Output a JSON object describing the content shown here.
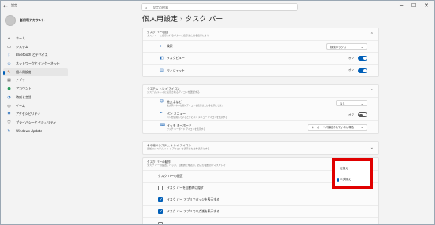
{
  "window": {
    "title": "設定",
    "back_icon": "arrow-left-icon",
    "search_placeholder": "設定の検索",
    "minimize": "─",
    "maximize": "☐",
    "close": "✕"
  },
  "profile": {
    "name": "者前利アカウント"
  },
  "sidebar": {
    "items": [
      {
        "label": "ホーム",
        "icon": "home-icon",
        "glyph": "⌂",
        "active": false
      },
      {
        "label": "システム",
        "icon": "monitor-icon",
        "glyph": "▭",
        "active": false
      },
      {
        "label": "Bluetooth とデバイス",
        "icon": "bluetooth-icon",
        "glyph": "ᛒ",
        "active": false
      },
      {
        "label": "ネットワークとインターネット",
        "icon": "wifi-icon",
        "glyph": "◇",
        "active": false
      },
      {
        "label": "個人用設定",
        "icon": "brush-icon",
        "glyph": "✎",
        "active": true
      },
      {
        "label": "アプリ",
        "icon": "apps-icon",
        "glyph": "▦",
        "active": false
      },
      {
        "label": "アカウント",
        "icon": "person-icon",
        "glyph": "●",
        "active": false
      },
      {
        "label": "時刻と言語",
        "icon": "globe-icon",
        "glyph": "◔",
        "active": false
      },
      {
        "label": "ゲーム",
        "icon": "gamepad-icon",
        "glyph": "◎",
        "active": false
      },
      {
        "label": "アクセシビリティ",
        "icon": "accessibility-icon",
        "glyph": "✱",
        "active": false
      },
      {
        "label": "プライバシーとセキュリティ",
        "icon": "shield-icon",
        "glyph": "⛉",
        "active": false
      },
      {
        "label": "Windows Update",
        "icon": "update-icon",
        "glyph": "↻",
        "active": false
      }
    ]
  },
  "breadcrumb": {
    "parent": "個人用設定",
    "separator": "›",
    "current": "タスク バー"
  },
  "taskbar_items": {
    "title": "タスク バー項目",
    "subtitle": "タスク バーに表示されるボタンを表示または非表示にする",
    "rows": [
      {
        "label": "検索",
        "icon": "search-icon",
        "glyph": "⌕",
        "control": "dropdown",
        "value": "検索ボックス"
      },
      {
        "label": "タスクビュー",
        "icon": "task-view-icon",
        "glyph": "◧",
        "control": "toggle",
        "state": "オン"
      },
      {
        "label": "ウィジェット",
        "icon": "widgets-icon",
        "glyph": "▤",
        "control": "toggle",
        "state": "オン"
      }
    ]
  },
  "system_tray": {
    "title": "システム トレイ アイコン",
    "subtitle": "システム トレイに表示されるアイコンを選択する",
    "rows": [
      {
        "label": "絵文字など",
        "desc": "絵文字パネルを開くアイコンを表示または非表示にします",
        "icon": "emoji-icon",
        "glyph": "☺",
        "control": "dropdown",
        "value": "なし"
      },
      {
        "label": "ペン メニュー",
        "desc": "ペンを使用しているときにペン メニュー アイコンを表示する",
        "icon": "pen-icon",
        "glyph": "✒",
        "control": "toggle",
        "state": "オフ"
      },
      {
        "label": "タッチ キーボード",
        "desc": "タッチ キーボード アイコンを表示する",
        "icon": "keyboard-icon",
        "glyph": "⌨",
        "control": "dropdown",
        "value": "キーボードが接続されていない場合"
      }
    ]
  },
  "other_tray": {
    "title": "その他のシステム トレイ アイコン",
    "subtitle": "追加のシステム トレイ アイコンを表示または非表示にする"
  },
  "behaviors": {
    "title": "タスク バーの動作",
    "subtitle": "タスク バーの配置、バッジ、自動的に非表示、および複数のディスプレイ",
    "alignment_label": "タスク バーの配置",
    "checks": [
      {
        "label": "タスク バーを自動的に隠す",
        "checked": false
      },
      {
        "label": "タスク バー アプリでバッジを表示する",
        "checked": true
      },
      {
        "label": "タスク バー アプリでの点滅を表示する",
        "checked": true
      },
      {
        "label": "",
        "checked": false
      }
    ]
  },
  "alignment_popup": {
    "options": [
      {
        "label": "左揃え",
        "selected": false
      },
      {
        "label": "中央揃え",
        "selected": true
      }
    ]
  },
  "colors": {
    "accent": "#005fb8",
    "highlight": "#e00000"
  }
}
